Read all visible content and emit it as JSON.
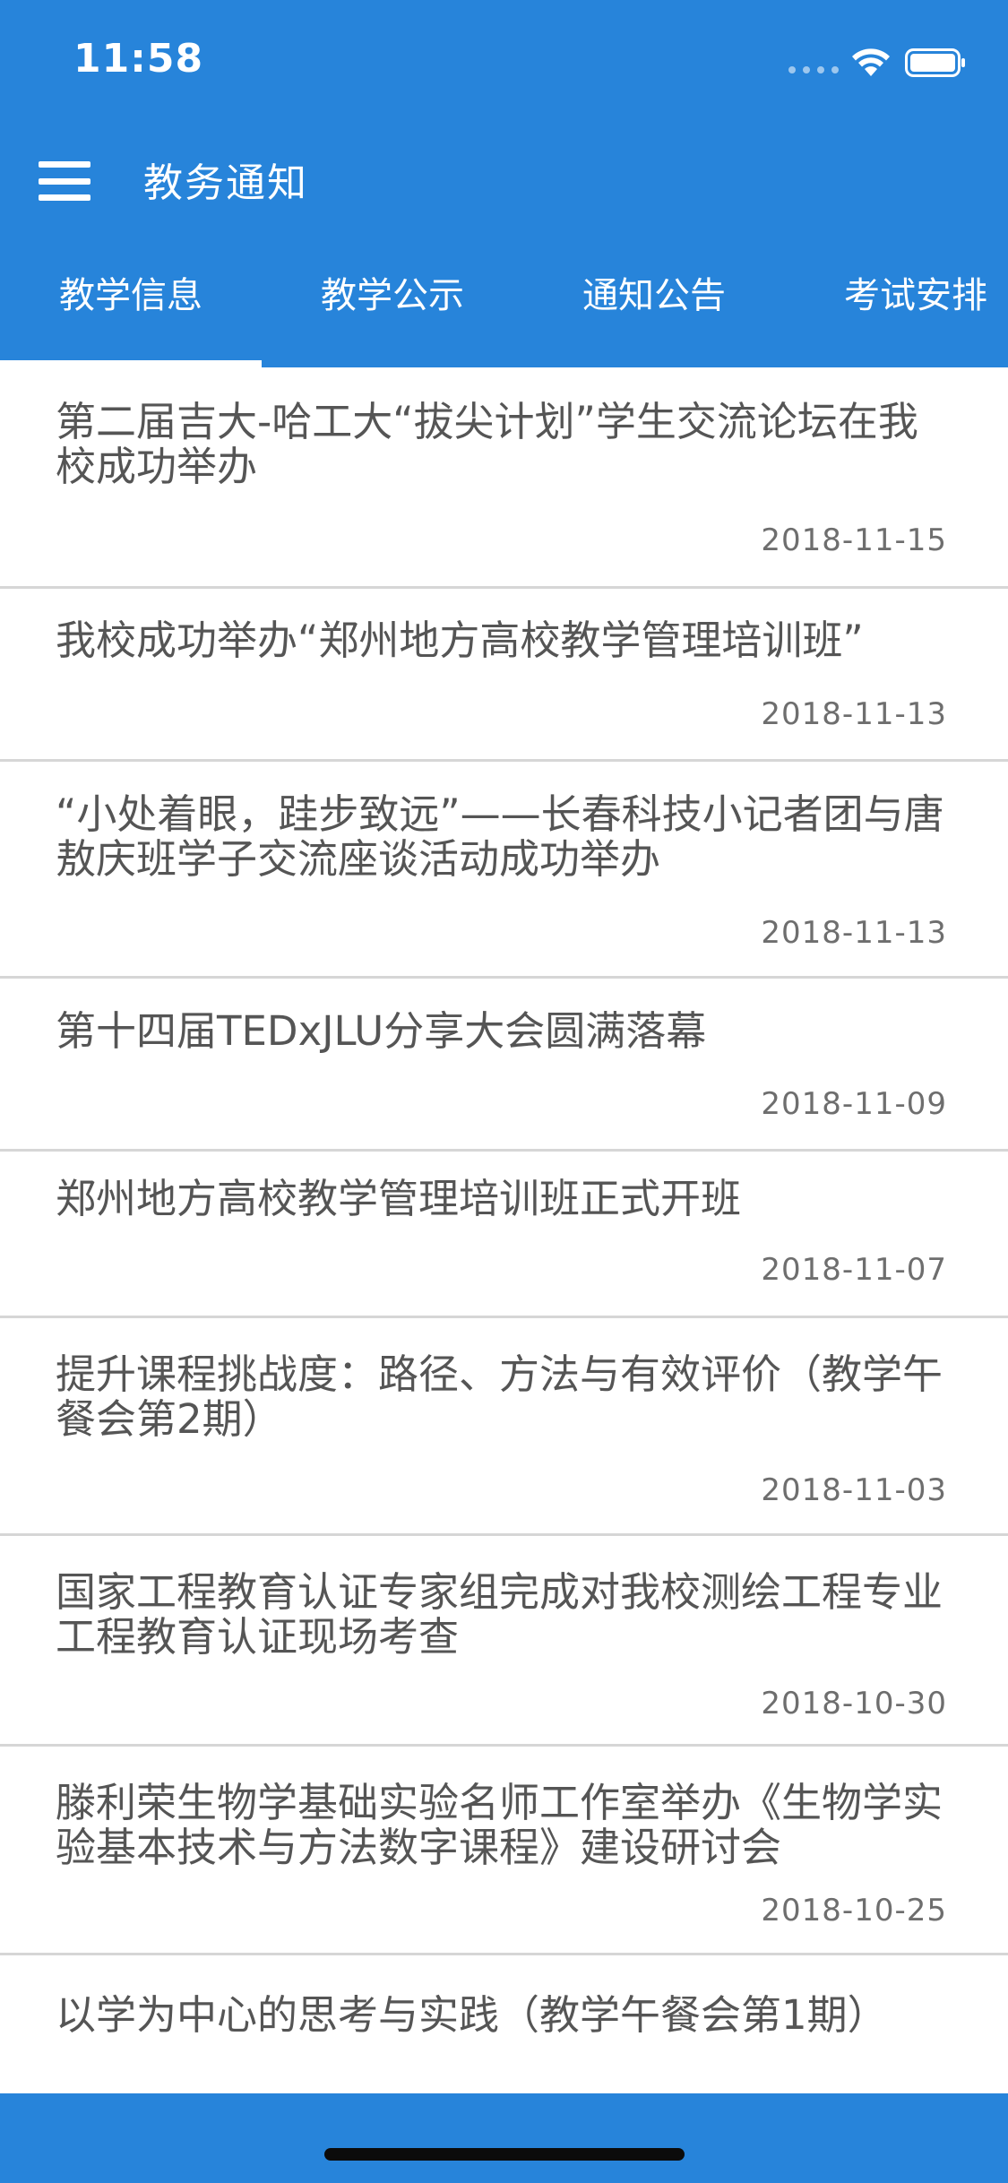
{
  "status_bar": {
    "time": "11:58"
  },
  "app_bar": {
    "title": "教务通知",
    "menu_icon": "hamburger-menu-icon"
  },
  "tabs": [
    {
      "label": "教学信息",
      "selected": true
    },
    {
      "label": "教学公示",
      "selected": false
    },
    {
      "label": "通知公告",
      "selected": false
    },
    {
      "label": "考试安排",
      "selected": false
    }
  ],
  "news": [
    {
      "title": "第二届吉大-哈工大“拔尖计划”学生交流论坛在我校成功举办",
      "date": "2018-11-15"
    },
    {
      "title": "我校成功举办“郑州地方高校教学管理培训班”",
      "date": "2018-11-13"
    },
    {
      "title": "“小处着眼，跬步致远”——长春科技小记者团与唐敖庆班学子交流座谈活动成功举办",
      "date": "2018-11-13"
    },
    {
      "title": "第十四届TEDxJLU分享大会圆满落幕",
      "date": "2018-11-09"
    },
    {
      "title": "郑州地方高校教学管理培训班正式开班",
      "date": "2018-11-07"
    },
    {
      "title": "提升课程挑战度：路径、方法与有效评价（教学午餐会第2期）",
      "date": "2018-11-03"
    },
    {
      "title": "国家工程教育认证专家组完成对我校测绘工程专业工程教育认证现场考查",
      "date": "2018-10-30"
    },
    {
      "title": "滕利荣生物学基础实验名师工作室举办《生物学实验基本技术与方法数字课程》建设研讨会",
      "date": "2018-10-25"
    },
    {
      "title": "以学为中心的思考与实践（教学午餐会第1期）",
      "date": ""
    }
  ],
  "colors": {
    "primary": "#2784DA",
    "text": "#555555",
    "date": "#6e6e6e",
    "divider": "#d6d6d6"
  }
}
